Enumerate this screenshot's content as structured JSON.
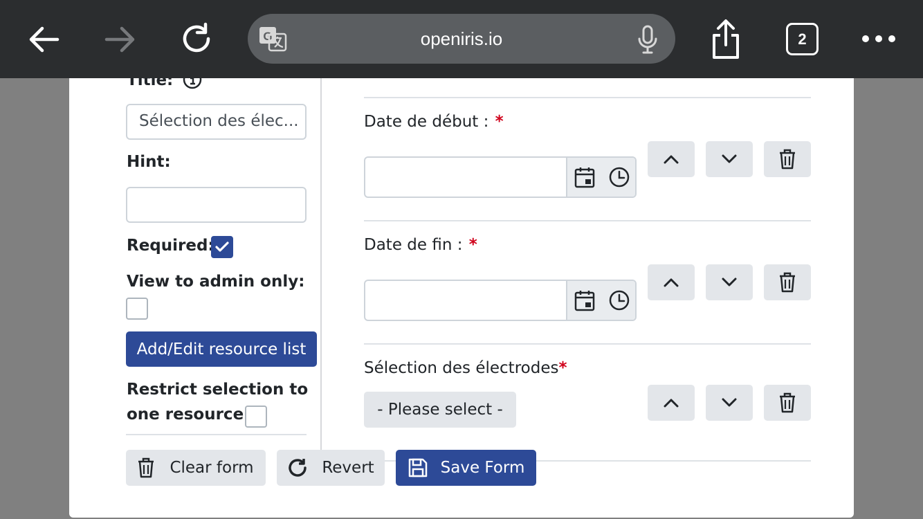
{
  "browser": {
    "url": "openiris.io",
    "tab_count": "2",
    "icons": {
      "back": "arrow-left-icon",
      "forward": "arrow-right-icon",
      "reload": "reload-icon",
      "translate": "translate-icon",
      "mic": "microphone-icon",
      "share": "share-icon",
      "more": "more-dots-icon"
    }
  },
  "left_panel": {
    "title_label": "Title:",
    "title_value": "Sélection des élec...",
    "hint_label": "Hint:",
    "hint_value": "",
    "required_label": "Required:",
    "required_checked": true,
    "view_admin_label": "View to admin only:",
    "view_admin_checked": false,
    "resource_list_button": "Add/Edit resource list",
    "restrict_label_line1": "Restrict selection to",
    "restrict_label_line2": "one resource:",
    "restrict_checked": false
  },
  "fields": [
    {
      "label": "Date de début :",
      "required_mark": "*",
      "type": "datetime"
    },
    {
      "label": "Date de fin :",
      "required_mark": "*",
      "type": "datetime"
    },
    {
      "label": "Sélection des électrodes",
      "required_mark": "*",
      "type": "select",
      "select_value": "- Please select -"
    }
  ],
  "footer": {
    "clear_label": "Clear form",
    "revert_label": "Revert",
    "save_label": "Save Form"
  },
  "colors": {
    "primary": "#2d4a97",
    "required": "#d0021b",
    "toolbar": "#2b2d2f"
  }
}
